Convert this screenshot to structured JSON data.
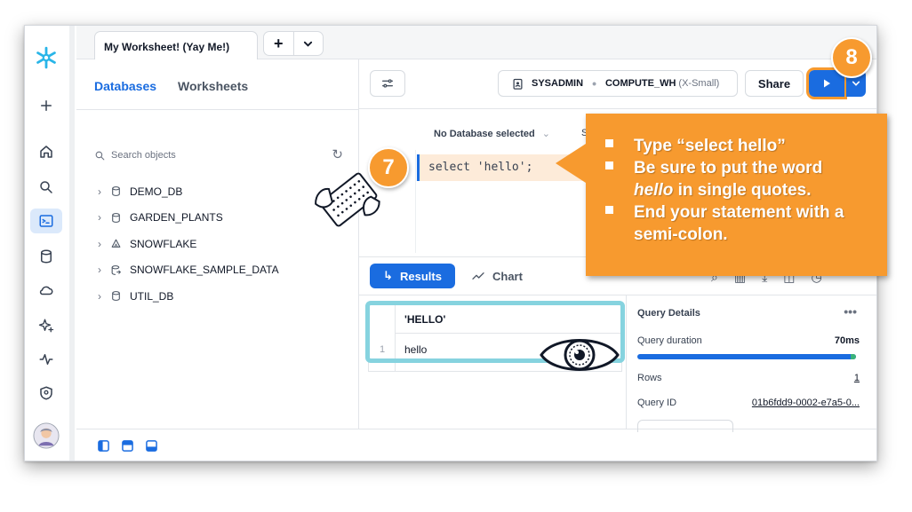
{
  "worksheet_tab": {
    "title": "My Worksheet! (Yay Me!)",
    "add_label": "+",
    "dropdown_label": "⌄"
  },
  "explorer": {
    "tabs": [
      "Databases",
      "Worksheets"
    ],
    "search_placeholder": "Search objects",
    "databases": [
      "DEMO_DB",
      "GARDEN_PLANTS",
      "SNOWFLAKE",
      "SNOWFLAKE_SAMPLE_DATA",
      "UTIL_DB"
    ]
  },
  "toolbar": {
    "role": "SYSADMIN",
    "warehouse": "COMPUTE_WH",
    "warehouse_size": "(X-Small)",
    "share_label": "Share"
  },
  "editor": {
    "database_select": "No Database selected",
    "schema_select_partial": "S",
    "code": "select 'hello';"
  },
  "results_bar": {
    "results_label": "Results",
    "chart_label": "Chart"
  },
  "result_grid": {
    "column": "'HELLO'",
    "row_number": "1",
    "value": "hello"
  },
  "query_details": {
    "title": "Query Details",
    "more": "•••",
    "duration_label": "Query duration",
    "duration_value": "70ms",
    "rows_label": "Rows",
    "rows_value": "1",
    "query_id_label": "Query ID",
    "query_id_value": "01b6fdd9-0002-e7a5-0..."
  },
  "callout": {
    "line1": "Type “select hello”",
    "line2": "Be sure to put the word",
    "line3_em": "hello",
    "line3_rest": " in single quotes.",
    "line4": "End your statement with a",
    "line5": "semi-colon."
  },
  "badges": {
    "step7": "7",
    "step8": "8"
  },
  "colors": {
    "accent": "#1a6ce0",
    "callout": "#f79a2f",
    "highlight": "#86d3df"
  }
}
